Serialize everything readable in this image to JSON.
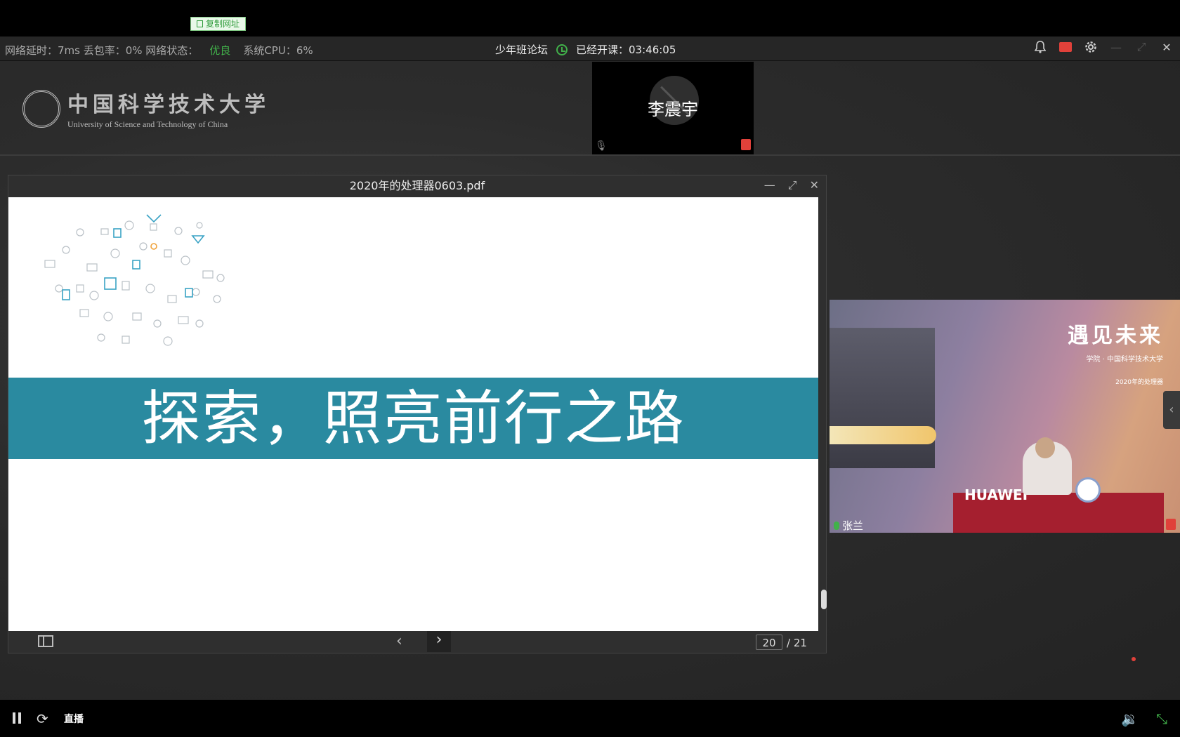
{
  "topbar": {
    "copy_url_label": "复制网址"
  },
  "status": {
    "network_stats": "网络延时：7ms  丢包率：0%  网络状态：",
    "network_state_value": "优良",
    "cpu": "系统CPU：6%",
    "course_name": "少年班论坛",
    "elapsed_label": "已经开课：03:46:05"
  },
  "window_controls": {
    "icons": [
      "bell-icon",
      "record-icon",
      "gear-icon",
      "minimize-icon",
      "maximize-icon",
      "close-icon"
    ],
    "close_glyph": "✕"
  },
  "logo": {
    "cn": "中国科学技术大学",
    "en": "University of Science and Technology of China"
  },
  "participant_top": {
    "name": "李震宇"
  },
  "pdf": {
    "title": "2020年的处理器0603.pdf",
    "banner_text": "探索，照亮前行之路",
    "page_current": "20",
    "page_total": "/ 21",
    "accent": "#2a8aa0"
  },
  "video": {
    "title": "遇见未来",
    "subtitle1": "学院 · 中国科学技术大学",
    "subtitle2": "2020年的处理器",
    "brand": "HUAWEI",
    "speaker_name": "张兰"
  },
  "player": {
    "live_label": "直播"
  },
  "colors": {
    "good": "#41b14a",
    "alert": "#e0413a"
  }
}
